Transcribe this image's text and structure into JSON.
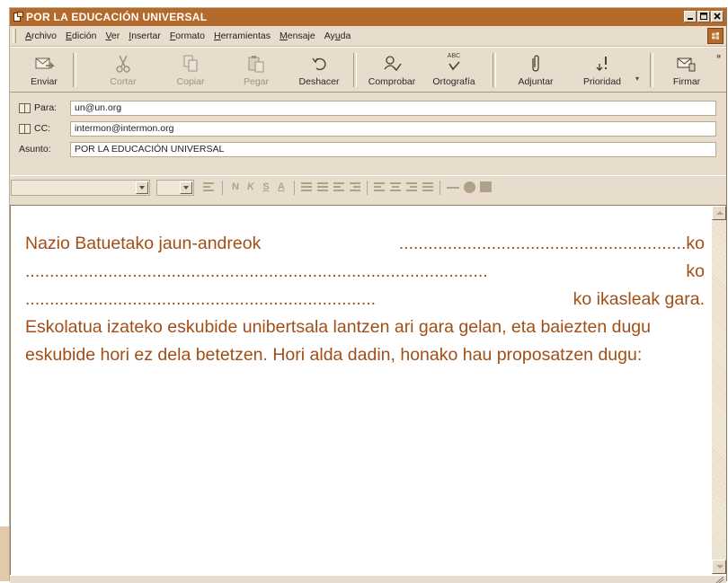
{
  "window": {
    "title": "POR LA EDUCACIÓN UNIVERSAL"
  },
  "menu": {
    "items": [
      {
        "pre": "",
        "key": "A",
        "post": "rchivo"
      },
      {
        "pre": "",
        "key": "E",
        "post": "dición"
      },
      {
        "pre": "",
        "key": "V",
        "post": "er"
      },
      {
        "pre": "",
        "key": "I",
        "post": "nsertar"
      },
      {
        "pre": "",
        "key": "F",
        "post": "ormato"
      },
      {
        "pre": "",
        "key": "H",
        "post": "erramientas"
      },
      {
        "pre": "",
        "key": "M",
        "post": "ensaje"
      },
      {
        "pre": "Ay",
        "key": "u",
        "post": "da"
      }
    ]
  },
  "toolbar": {
    "send": "Enviar",
    "cut": "Cortar",
    "copy": "Copiar",
    "paste": "Pegar",
    "undo": "Deshacer",
    "check": "Comprobar",
    "spelling": "Ortografía",
    "attach": "Adjuntar",
    "priority": "Prioridad",
    "sign": "Firmar",
    "more": "»",
    "abc": "ABC"
  },
  "header": {
    "to_label": "Para:",
    "to_value": "un@un.org",
    "cc_label": "CC:",
    "cc_value": "intermon@intermon.org",
    "subject_label": "Asunto:",
    "subject_value": "POR LA EDUCACIÓN UNIVERSAL"
  },
  "format_icons": {
    "bold": "N",
    "italic": "K",
    "underline": "S",
    "color": "A"
  },
  "body": {
    "line1_text": "Nazio Batuetako jaun-andreok",
    "line1_dots": "...........................................................",
    "line1_end": "ko",
    "line2_dots": "...............................................................................................",
    "line2_end": "ko",
    "line3_dots": "........................................................................",
    "line3_end": " ko ikasleak gara.",
    "paragraph": "Eskolatua izateko eskubide unibertsala lantzen ari gara gelan, eta baiezten dugu eskubide hori ez dela betetzen. Hori alda dadin, honako hau proposatzen dugu:"
  },
  "colors": {
    "title_bar": "#b46a2a",
    "body_text": "#a14e17",
    "chrome": "#e8dccc"
  }
}
